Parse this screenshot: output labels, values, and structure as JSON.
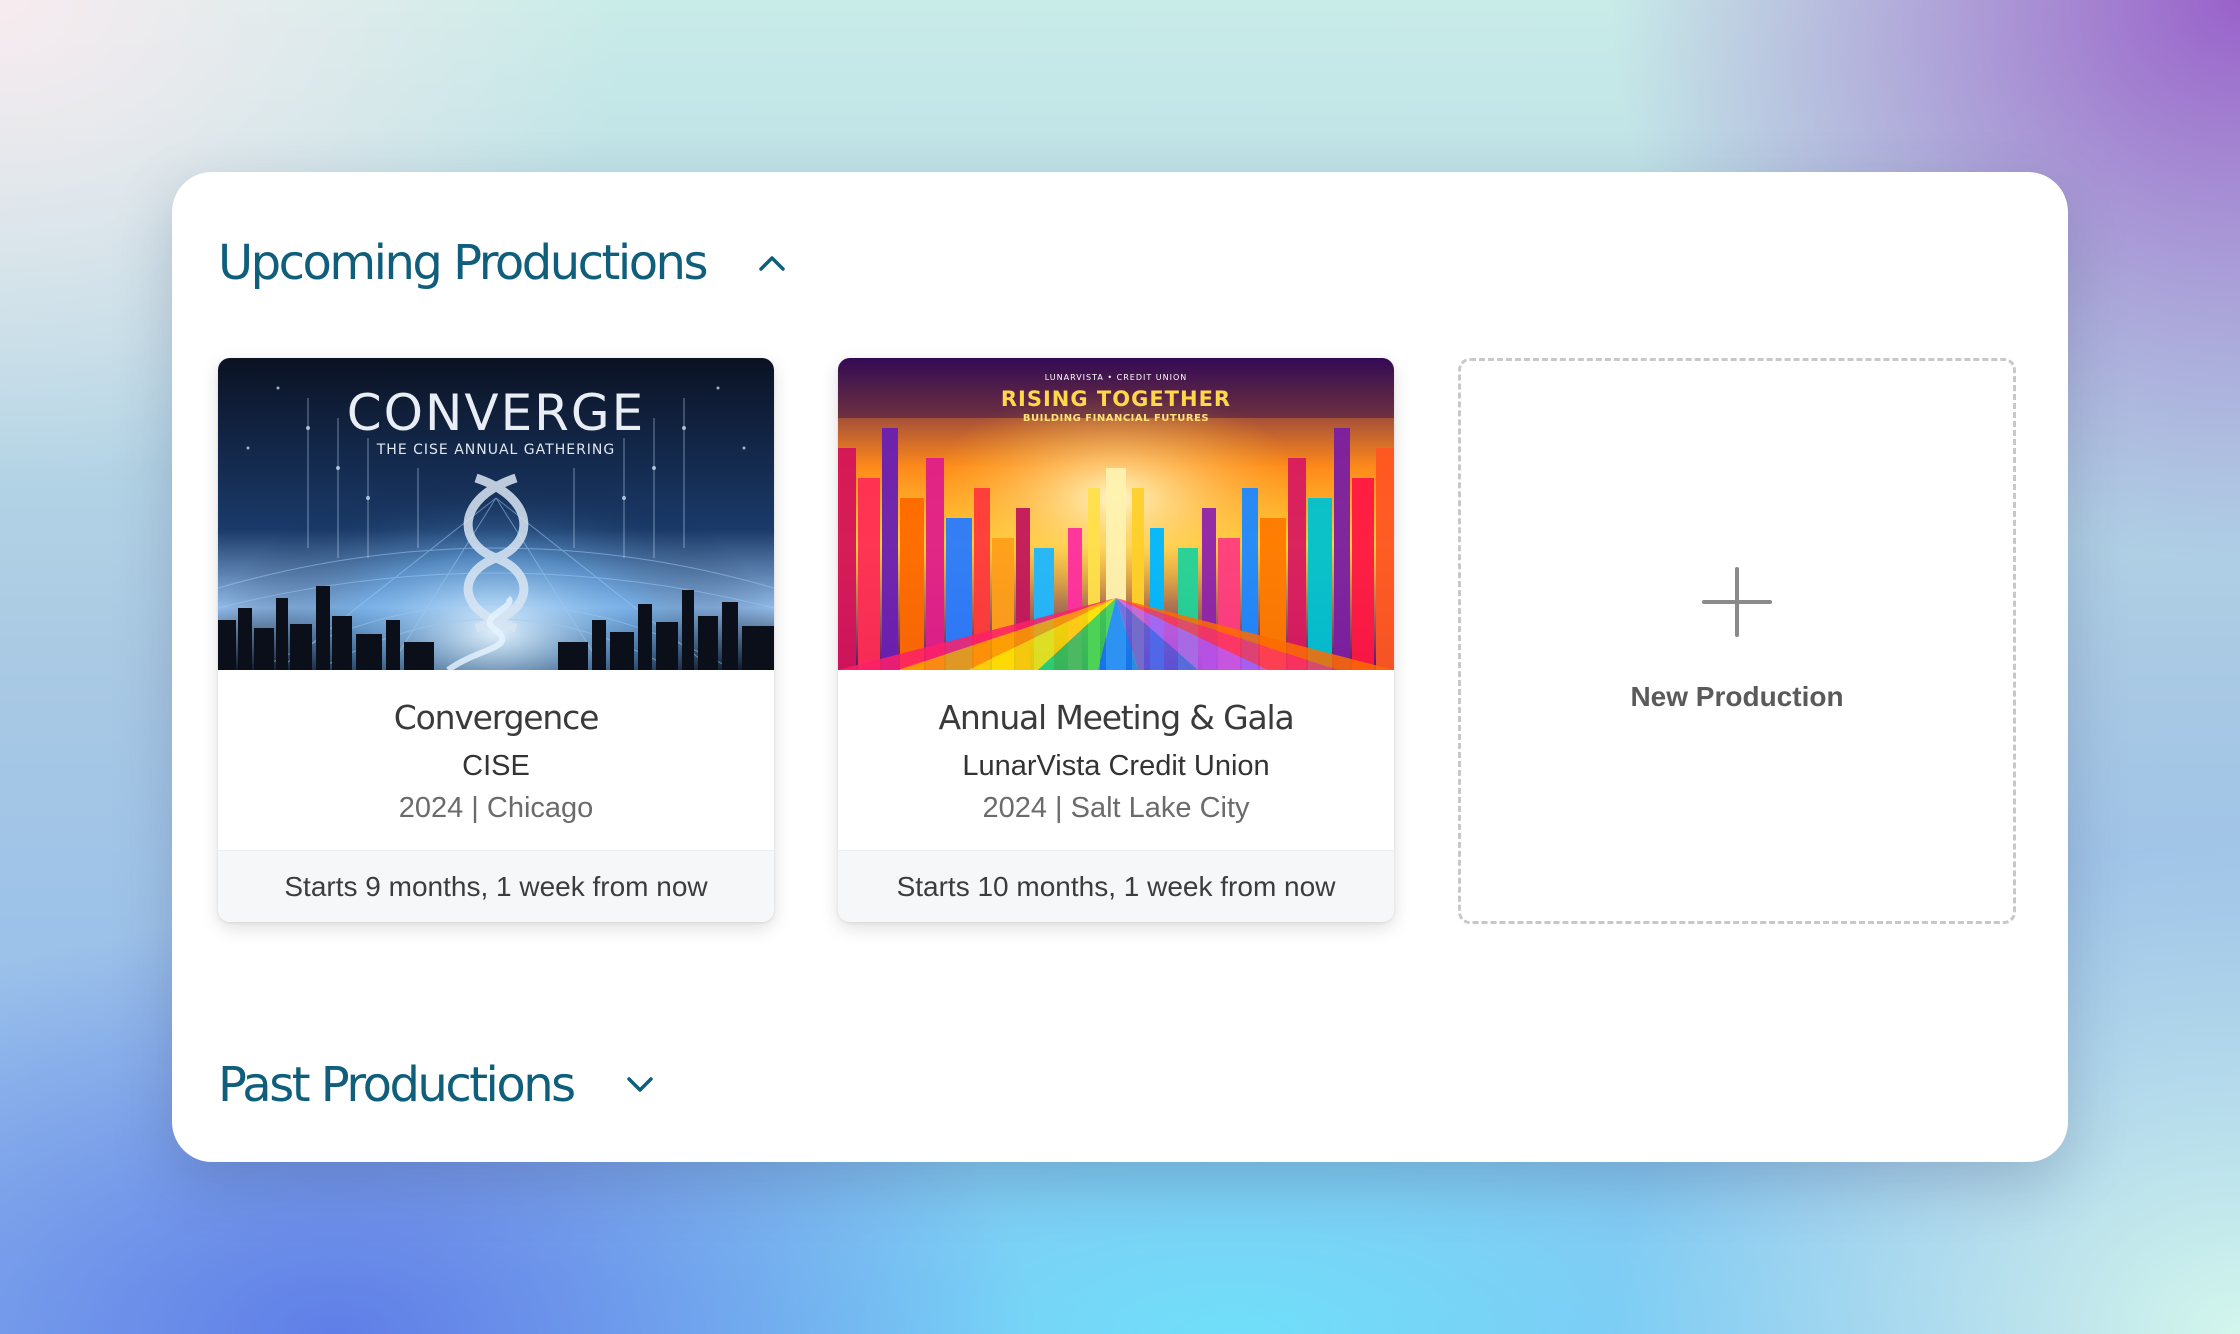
{
  "upcoming": {
    "title": "Upcoming Productions",
    "toggle_icon": "chevron-up-icon"
  },
  "productions": [
    {
      "title": "Convergence",
      "organization": "CISE",
      "meta": "2024 | Chicago",
      "starts": "Starts 9 months, 1 week from now",
      "poster": {
        "headline": "CONVERGE",
        "subline": "THE CISE ANNUAL GATHERING"
      }
    },
    {
      "title": "Annual Meeting & Gala",
      "organization": "LunarVista Credit Union",
      "meta": "2024 | Salt Lake City",
      "starts": "Starts 10 months, 1 week from now",
      "poster": {
        "brand": "LUNARVISTA • CREDIT UNION",
        "headline": "RISING TOGETHER",
        "subline": "BUILDING FINANCIAL FUTURES"
      }
    }
  ],
  "new_production": {
    "label": "New Production",
    "icon": "plus-icon"
  },
  "past": {
    "title": "Past Productions",
    "toggle_icon": "chevron-down-icon"
  },
  "colors": {
    "heading": "#0f5f7c",
    "card_footer_bg": "#f5f7f8",
    "dashed_border": "#c8c8c8"
  }
}
